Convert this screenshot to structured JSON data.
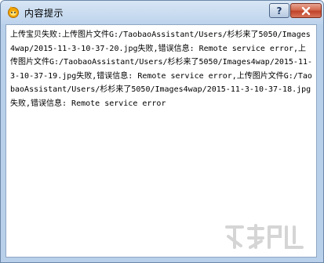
{
  "window": {
    "title": "内容提示"
  },
  "message": {
    "text": "上传宝贝失败:上传图片文件G:/TaobaoAssistant/Users/杉杉来了5050/Images4wap/2015-11-3-10-37-20.jpg失败,错误信息: Remote service error,上传图片文件G:/TaobaoAssistant/Users/杉杉来了5050/Images4wap/2015-11-3-10-37-19.jpg失败,错误信息: Remote service error,上传图片文件G:/TaobaoAssistant/Users/杉杉来了5050/Images4wap/2015-11-3-10-37-18.jpg失败,错误信息: Remote service error"
  },
  "icons": {
    "app": "wangwang-logo-icon",
    "help": "help-icon",
    "close": "close-icon",
    "watermark": "site-watermark-logo"
  },
  "colors": {
    "titlebar": "#bdd3ec",
    "close_button": "#c0432a",
    "background": "#ffffff"
  }
}
